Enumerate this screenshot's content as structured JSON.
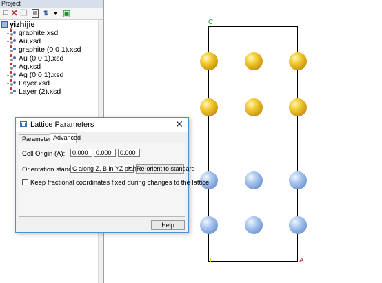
{
  "project_panel": {
    "title": "Project",
    "toolbar_icons": [
      "new-document-icon",
      "delete-icon",
      "copy-icon",
      "properties-icon",
      "sort-icon",
      "dropdown-arrow-icon",
      "bookmark-icon"
    ],
    "root": {
      "label": "yizhijie",
      "icon": "project-folder-icon"
    },
    "items": [
      {
        "label": "graphite.xsd",
        "icon": "molecule-document-icon"
      },
      {
        "label": "Au.xsd",
        "icon": "molecule-document-icon"
      },
      {
        "label": "graphite (0 0 1).xsd",
        "icon": "molecule-document-icon"
      },
      {
        "label": "Au (0 0 1).xsd",
        "icon": "molecule-document-icon"
      },
      {
        "label": "Ag.xsd",
        "icon": "molecule-document-icon"
      },
      {
        "label": "Ag (0 0 1).xsd",
        "icon": "molecule-document-icon"
      },
      {
        "label": "Layer.xsd",
        "icon": "molecule-document-icon"
      },
      {
        "label": "Layer (2).xsd",
        "icon": "molecule-document-icon"
      }
    ]
  },
  "viewer": {
    "axis_c": "C",
    "axis_a": "A",
    "colors": {
      "au": "#f0c020",
      "ag": "#9ab8e8",
      "axis_c": "#1c9c2c",
      "axis_a": "#d02020"
    }
  },
  "dialog": {
    "title": "Lattice Parameters",
    "tabs": [
      {
        "label": "Parameters",
        "active": false
      },
      {
        "label": "Advanced",
        "active": true
      }
    ],
    "cell_origin_label": "Cell Origin (A):",
    "cell_origin_values": [
      "0.000",
      "0.000",
      "0.000"
    ],
    "orientation_label": "Orientation standard:",
    "orientation_value": "C along Z, B in YZ plane",
    "reorient_button": "Re-orient to standard",
    "fix_fractional_label": "Keep fractional coordinates fixed during changes to the lattice",
    "fix_fractional_checked": false,
    "help_button": "Help"
  }
}
